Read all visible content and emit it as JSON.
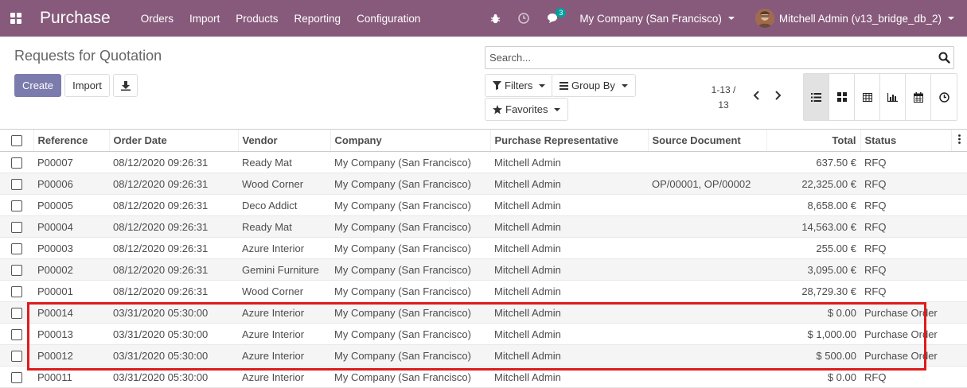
{
  "app": {
    "brand": "Purchase"
  },
  "menu": [
    "Orders",
    "Import",
    "Products",
    "Reporting",
    "Configuration"
  ],
  "systray": {
    "chat_badge": "3",
    "company": "My Company (San Francisco)",
    "user": "Mitchell Admin (v13_bridge_db_2)"
  },
  "page": {
    "title": "Requests for Quotation",
    "create_label": "Create",
    "import_label": "Import"
  },
  "search": {
    "placeholder": "Search..."
  },
  "filters": {
    "filters_label": "Filters",
    "groupby_label": "Group By",
    "favorites_label": "Favorites"
  },
  "pager": {
    "range": "1-13 /",
    "total": "13"
  },
  "views": [
    "list-icon",
    "kanban-icon",
    "pivot-icon",
    "graph-icon",
    "calendar-icon",
    "activity-icon"
  ],
  "colors": {
    "navbar": "#875a7b",
    "primary_button": "#7c7bad",
    "highlight": "#e01b1b"
  },
  "table": {
    "columns": [
      "Reference",
      "Order Date",
      "Vendor",
      "Company",
      "Purchase Representative",
      "Source Document",
      "Total",
      "Status"
    ],
    "rows": [
      [
        "P00007",
        "08/12/2020 09:26:31",
        "Ready Mat",
        "My Company (San Francisco)",
        "Mitchell Admin",
        "",
        "637.50 €",
        "RFQ"
      ],
      [
        "P00006",
        "08/12/2020 09:26:31",
        "Wood Corner",
        "My Company (San Francisco)",
        "Mitchell Admin",
        "OP/00001, OP/00002",
        "22,325.00 €",
        "RFQ"
      ],
      [
        "P00005",
        "08/12/2020 09:26:31",
        "Deco Addict",
        "My Company (San Francisco)",
        "Mitchell Admin",
        "",
        "8,658.00 €",
        "RFQ"
      ],
      [
        "P00004",
        "08/12/2020 09:26:31",
        "Ready Mat",
        "My Company (San Francisco)",
        "Mitchell Admin",
        "",
        "14,563.00 €",
        "RFQ"
      ],
      [
        "P00003",
        "08/12/2020 09:26:31",
        "Azure Interior",
        "My Company (San Francisco)",
        "Mitchell Admin",
        "",
        "255.00 €",
        "RFQ"
      ],
      [
        "P00002",
        "08/12/2020 09:26:31",
        "Gemini Furniture",
        "My Company (San Francisco)",
        "Mitchell Admin",
        "",
        "3,095.00 €",
        "RFQ"
      ],
      [
        "P00001",
        "08/12/2020 09:26:31",
        "Wood Corner",
        "My Company (San Francisco)",
        "Mitchell Admin",
        "",
        "28,729.30 €",
        "RFQ"
      ],
      [
        "P00014",
        "03/31/2020 05:30:00",
        "Azure Interior",
        "My Company (San Francisco)",
        "Mitchell Admin",
        "",
        "$ 0.00",
        "Purchase Order"
      ],
      [
        "P00013",
        "03/31/2020 05:30:00",
        "Azure Interior",
        "My Company (San Francisco)",
        "Mitchell Admin",
        "",
        "$ 1,000.00",
        "Purchase Order"
      ],
      [
        "P00012",
        "03/31/2020 05:30:00",
        "Azure Interior",
        "My Company (San Francisco)",
        "Mitchell Admin",
        "",
        "$ 500.00",
        "Purchase Order"
      ],
      [
        "P00011",
        "03/31/2020 05:30:00",
        "Azure Interior",
        "My Company (San Francisco)",
        "Mitchell Admin",
        "",
        "$ 0.00",
        "RFQ"
      ]
    ]
  }
}
